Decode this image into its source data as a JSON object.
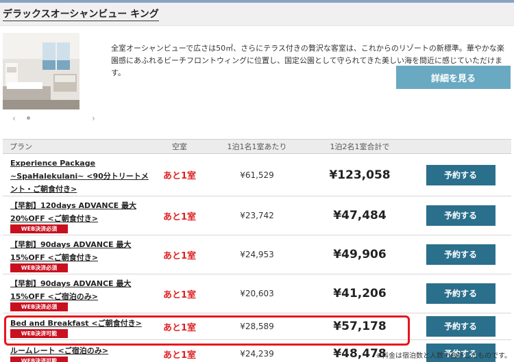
{
  "room": {
    "title": "デラックスオーシャンビュー キング",
    "description": "全室オーシャンビューで広さは50㎡、さらにテラス付きの贅沢な客室は、これからのリゾートの新標準。華やかな楽園感にあふれるビーチフロントウィングに位置し、国定公園として守られてきた美しい海を間近に感じていただけます。",
    "detail_button": "詳細を見る"
  },
  "carousel": {
    "prev_icon": "‹",
    "next_icon": "›"
  },
  "table": {
    "headers": {
      "plan": "プラン",
      "vacancy": "空室",
      "per_person": "1泊1名1室あたり",
      "total": "1泊2名1室合計で"
    },
    "rows": [
      {
        "name": "Experience Package ~SpaHalekulani~ <90分トリートメント・ご朝食付き>",
        "badge": "",
        "vacancy": "あと1室",
        "per_person": "¥61,529",
        "total": "¥123,058",
        "button": "予約する"
      },
      {
        "name": "【早割】120days ADVANCE 最大20%OFF <ご朝食付き>",
        "badge": "WEB決済必須",
        "vacancy": "あと1室",
        "per_person": "¥23,742",
        "total": "¥47,484",
        "button": "予約する"
      },
      {
        "name": "【早割】90days ADVANCE 最大15%OFF <ご朝食付き>",
        "badge": "WEB決済必須",
        "vacancy": "あと1室",
        "per_person": "¥24,953",
        "total": "¥49,906",
        "button": "予約する"
      },
      {
        "name": "【早割】90days ADVANCE 最大15%OFF <ご宿泊のみ>",
        "badge": "WEB決済必須",
        "vacancy": "あと1室",
        "per_person": "¥20,603",
        "total": "¥41,206",
        "button": "予約する"
      },
      {
        "name": "Bed and Breakfast <ご朝食付き>",
        "badge": "WEB決済可能",
        "vacancy": "あと1室",
        "per_person": "¥28,589",
        "total": "¥57,178",
        "button": "予約する"
      },
      {
        "name": "ルームレート <ご宿泊のみ>",
        "badge": "WEB決済可能",
        "vacancy": "あと1室",
        "per_person": "¥24,239",
        "total": "¥48,478",
        "button": "予約する"
      }
    ]
  },
  "footnote": "※料金は宿泊数と人数で合計したものです。",
  "colors": {
    "header_rule": "#8aa3c4",
    "detail_button": "#6aa9c2",
    "book_button": "#2a6f8c",
    "vacancy_text": "#e02020",
    "badge": "#c8101f",
    "highlight": "#e8131b"
  }
}
